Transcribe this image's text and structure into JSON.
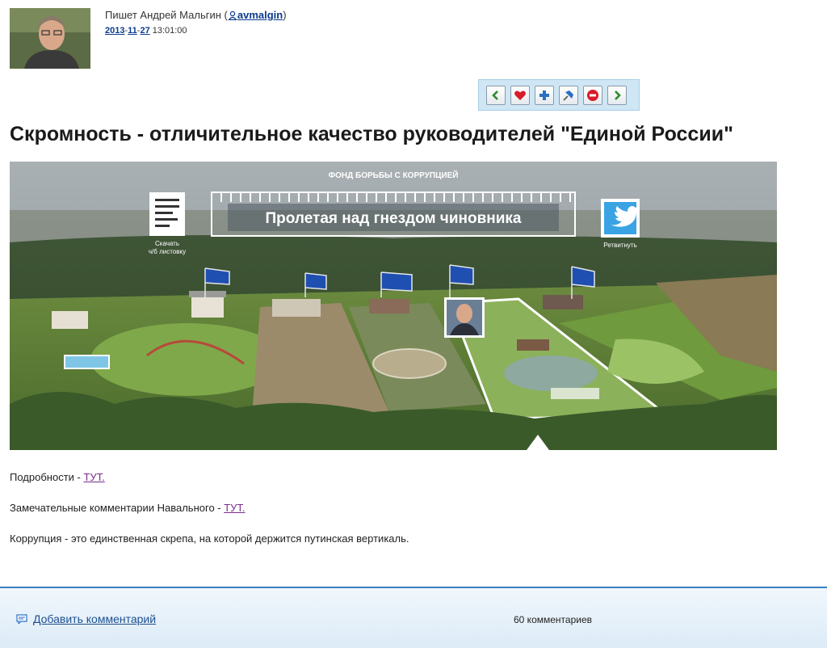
{
  "author": {
    "prefix": "Пишет Андрей Мальгин (",
    "username": "avmalgin",
    "suffix": ")",
    "date_year": "2013",
    "date_month": "11",
    "date_day": "27",
    "time": "13:01:00"
  },
  "toolbar": {
    "buttons": [
      "prev-icon",
      "heart-icon",
      "plus-icon",
      "pin-icon",
      "stop-icon",
      "next-icon"
    ]
  },
  "post": {
    "title": "Скромность - отличительное качество руководителей \"Единой России\""
  },
  "banner": {
    "top_caption": "ФОНД БОРЬБЫ С КОРРУПЦИЕЙ",
    "headline": "Пролетая над гнездом чиновника",
    "download_label_1": "Скачать",
    "download_label_2": "ч/б листовку",
    "retweet_label": "Ретвитнуть"
  },
  "body": {
    "p1_text": "Подробности - ",
    "p1_link": "ТУТ.",
    "p2_text": "Замечательные комментарии Навального - ",
    "p2_link": "ТУТ.",
    "p3_text": "Коррупция - это единственная скрепа, на которой держится путинская вертикаль."
  },
  "footer": {
    "add_comment": "Добавить комментарий",
    "comment_count": "60 комментариев"
  },
  "colors": {
    "link": "#0b3b8c",
    "visited_link": "#7a2b8c",
    "toolbar_bg": "#cfe6f5",
    "footer_border": "#3b7fc4"
  }
}
